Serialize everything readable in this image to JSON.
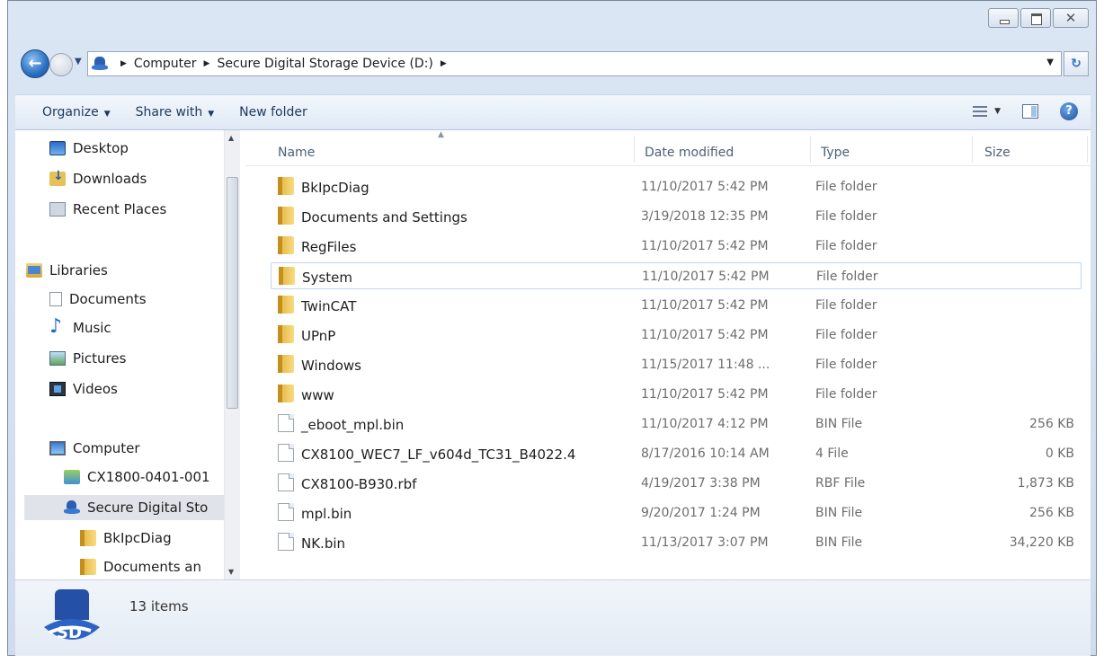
{
  "window": {
    "caption": {
      "min_label": "",
      "max_label": "",
      "close_label": "✕"
    }
  },
  "address_bar": {
    "crumbs": [
      "Computer",
      "Secure Digital Storage Device (D:)"
    ],
    "separator": "▶"
  },
  "toolbar": {
    "organize": "Organize",
    "share_with": "Share with",
    "new_folder": "New folder",
    "caret": "▼",
    "help": "?"
  },
  "nav_pane": {
    "items": [
      {
        "label": "Desktop",
        "icon": "desktop-icon"
      },
      {
        "label": "Downloads",
        "icon": "downloads-icon"
      },
      {
        "label": "Recent Places",
        "icon": "recent-places-icon"
      },
      {
        "label": "Libraries",
        "icon": "libraries-icon"
      },
      {
        "label": "Documents",
        "icon": "documents-icon"
      },
      {
        "label": "Music",
        "icon": "music-icon"
      },
      {
        "label": "Pictures",
        "icon": "pictures-icon"
      },
      {
        "label": "Videos",
        "icon": "videos-icon"
      },
      {
        "label": "Computer",
        "icon": "computer-icon"
      },
      {
        "label": "CX1800-0401-001",
        "icon": "network-drive-icon"
      },
      {
        "label": "Secure Digital Sto",
        "icon": "sd-card-icon",
        "selected": true
      },
      {
        "label": "BkIpcDiag",
        "icon": "folder-icon"
      },
      {
        "label": "Documents an",
        "icon": "folder-icon"
      }
    ]
  },
  "file_list": {
    "columns": {
      "name": "Name",
      "date": "Date modified",
      "type": "Type",
      "size": "Size"
    },
    "rows": [
      {
        "name": "BkIpcDiag",
        "date": "11/10/2017 5:42 PM",
        "type": "File folder",
        "size": "",
        "kind": "folder"
      },
      {
        "name": "Documents and Settings",
        "date": "3/19/2018 12:35 PM",
        "type": "File folder",
        "size": "",
        "kind": "folder"
      },
      {
        "name": "RegFiles",
        "date": "11/10/2017 5:42 PM",
        "type": "File folder",
        "size": "",
        "kind": "folder"
      },
      {
        "name": "System",
        "date": "11/10/2017 5:42 PM",
        "type": "File folder",
        "size": "",
        "kind": "folder",
        "selected": true
      },
      {
        "name": "TwinCAT",
        "date": "11/10/2017 5:42 PM",
        "type": "File folder",
        "size": "",
        "kind": "folder"
      },
      {
        "name": "UPnP",
        "date": "11/10/2017 5:42 PM",
        "type": "File folder",
        "size": "",
        "kind": "folder"
      },
      {
        "name": "Windows",
        "date": "11/15/2017 11:48 ...",
        "type": "File folder",
        "size": "",
        "kind": "folder"
      },
      {
        "name": "www",
        "date": "11/10/2017 5:42 PM",
        "type": "File folder",
        "size": "",
        "kind": "folder"
      },
      {
        "name": "_eboot_mpl.bin",
        "date": "11/10/2017 4:12 PM",
        "type": "BIN File",
        "size": "256 KB",
        "kind": "file"
      },
      {
        "name": "CX8100_WEC7_LF_v604d_TC31_B4022.4",
        "date": "8/17/2016 10:14 AM",
        "type": "4 File",
        "size": "0 KB",
        "kind": "file"
      },
      {
        "name": "CX8100-B930.rbf",
        "date": "4/19/2017 3:38 PM",
        "type": "RBF File",
        "size": "1,873 KB",
        "kind": "file"
      },
      {
        "name": "mpl.bin",
        "date": "9/20/2017 1:24 PM",
        "type": "BIN File",
        "size": "256 KB",
        "kind": "file"
      },
      {
        "name": "NK.bin",
        "date": "11/13/2017 3:07 PM",
        "type": "BIN File",
        "size": "34,220 KB",
        "kind": "file"
      }
    ]
  },
  "details": {
    "count": "13 items"
  }
}
